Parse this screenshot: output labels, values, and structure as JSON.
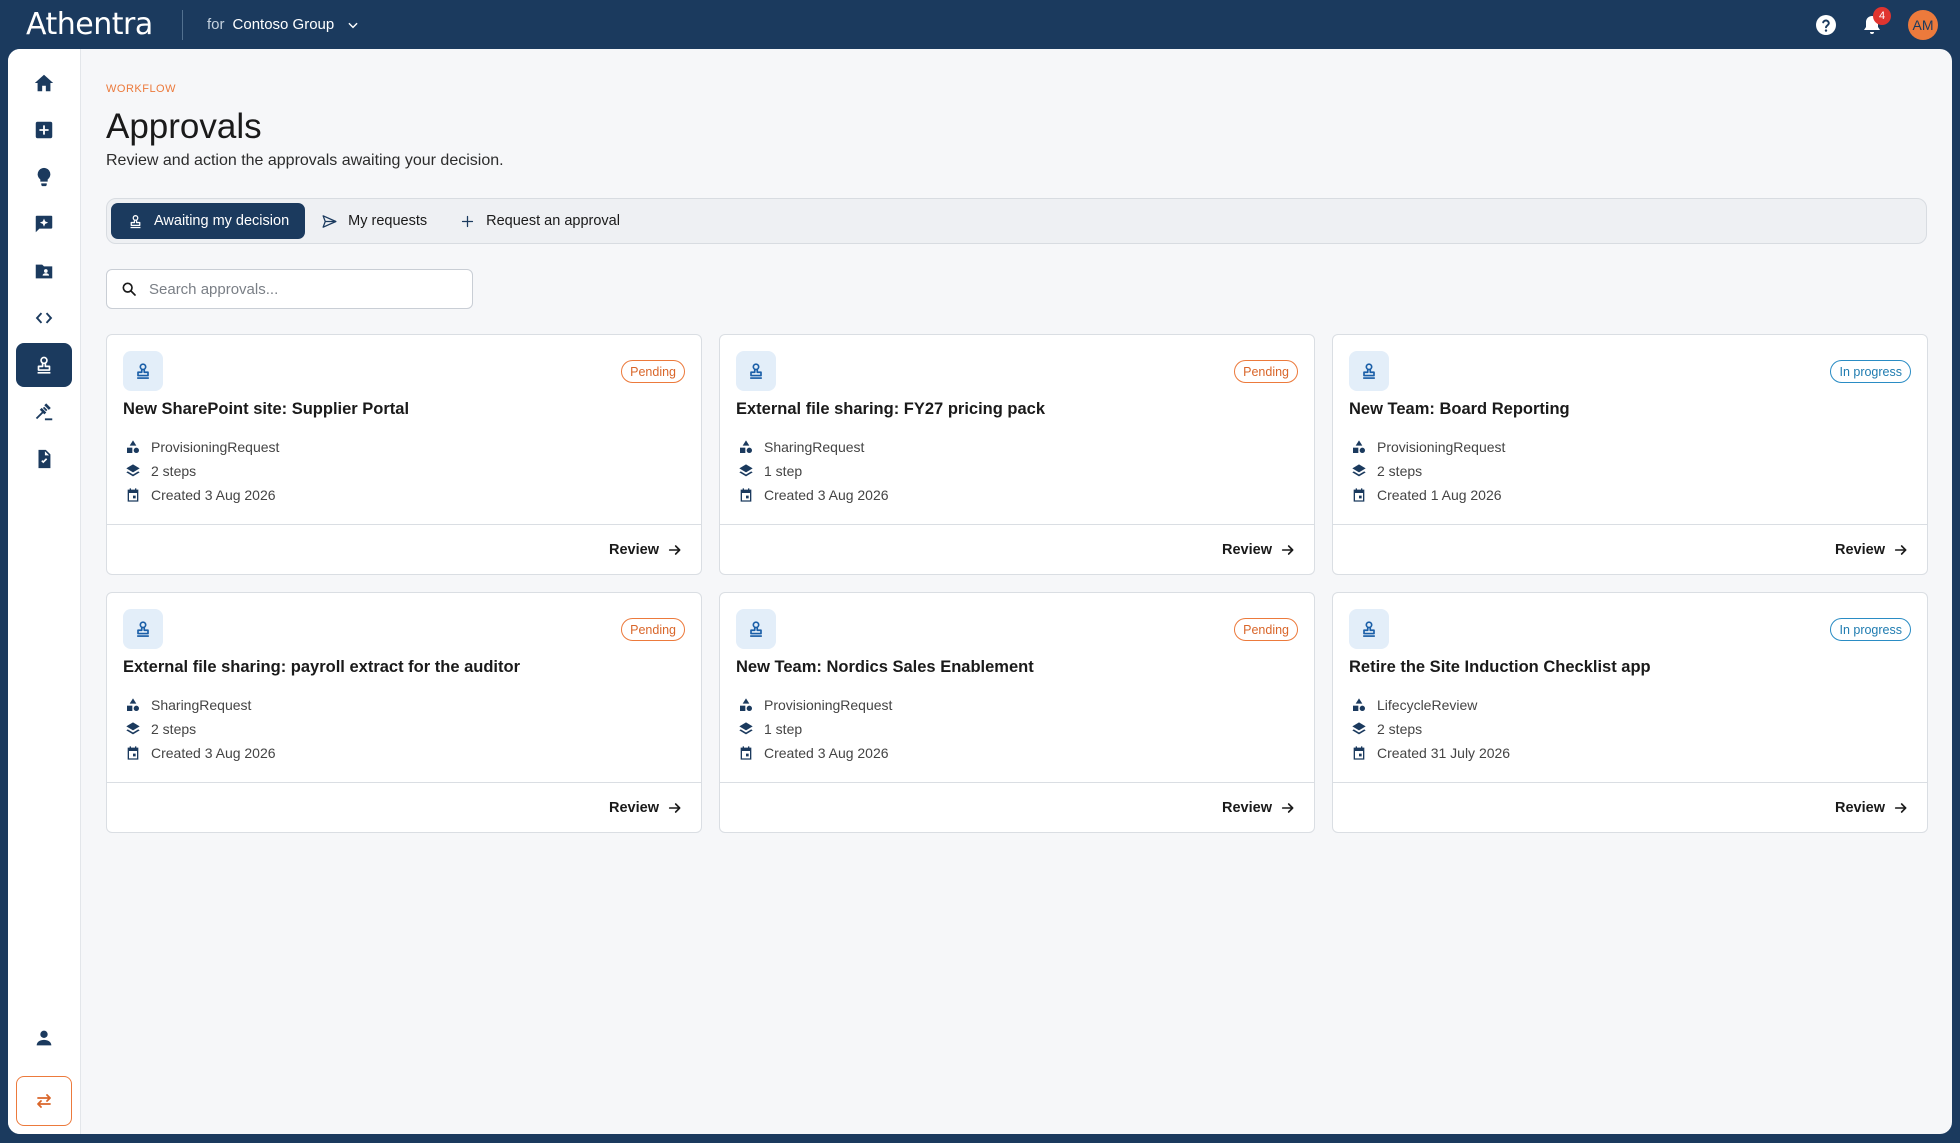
{
  "header": {
    "brand": "Athentra",
    "org_prefix": "for",
    "org_name": "Contoso Group",
    "notification_count": "4",
    "avatar_initials": "AM"
  },
  "sidebar": {
    "items": [
      {
        "icon": "home-icon"
      },
      {
        "icon": "add-box-icon"
      },
      {
        "icon": "lightbulb-icon"
      },
      {
        "icon": "chat-sparkle-icon"
      },
      {
        "icon": "folder-user-icon"
      },
      {
        "icon": "code-icon"
      },
      {
        "icon": "stamp-icon",
        "active": true
      },
      {
        "icon": "gavel-icon"
      },
      {
        "icon": "task-document-icon"
      }
    ],
    "bottom_items": [
      {
        "icon": "person-icon"
      },
      {
        "icon": "swap-icon"
      }
    ]
  },
  "page": {
    "eyebrow": "WORKFLOW",
    "title": "Approvals",
    "subtitle": "Review and action the approvals awaiting your decision."
  },
  "tabs": [
    {
      "label": "Awaiting my decision",
      "active": true
    },
    {
      "label": "My requests",
      "active": false
    },
    {
      "label": "Request an approval",
      "active": false
    }
  ],
  "search": {
    "placeholder": "Search approvals..."
  },
  "cards": [
    {
      "title": "New SharePoint site: Supplier Portal",
      "status": "Pending",
      "type": "ProvisioningRequest",
      "steps": "2 steps",
      "created": "Created 3 Aug 2026",
      "action": "Review"
    },
    {
      "title": "External file sharing: FY27 pricing pack",
      "status": "Pending",
      "type": "SharingRequest",
      "steps": "1 step",
      "created": "Created 3 Aug 2026",
      "action": "Review"
    },
    {
      "title": "New Team: Board Reporting",
      "status": "In progress",
      "type": "ProvisioningRequest",
      "steps": "2 steps",
      "created": "Created 1 Aug 2026",
      "action": "Review"
    },
    {
      "title": "External file sharing: payroll extract for the auditor",
      "status": "Pending",
      "type": "SharingRequest",
      "steps": "2 steps",
      "created": "Created 3 Aug 2026",
      "action": "Review"
    },
    {
      "title": "New Team: Nordics Sales Enablement",
      "status": "Pending",
      "type": "ProvisioningRequest",
      "steps": "1 step",
      "created": "Created 3 Aug 2026",
      "action": "Review"
    },
    {
      "title": "Retire the Site Induction Checklist app",
      "status": "In progress",
      "type": "LifecycleReview",
      "steps": "2 steps",
      "created": "Created 31 July 2026",
      "action": "Review"
    }
  ],
  "colors": {
    "navy": "#1b3a5e",
    "accent_orange": "#ec7a3c",
    "status_pending": "#ec7a3c",
    "status_in_progress": "#2a8cc4",
    "background": "#f6f7f9"
  }
}
